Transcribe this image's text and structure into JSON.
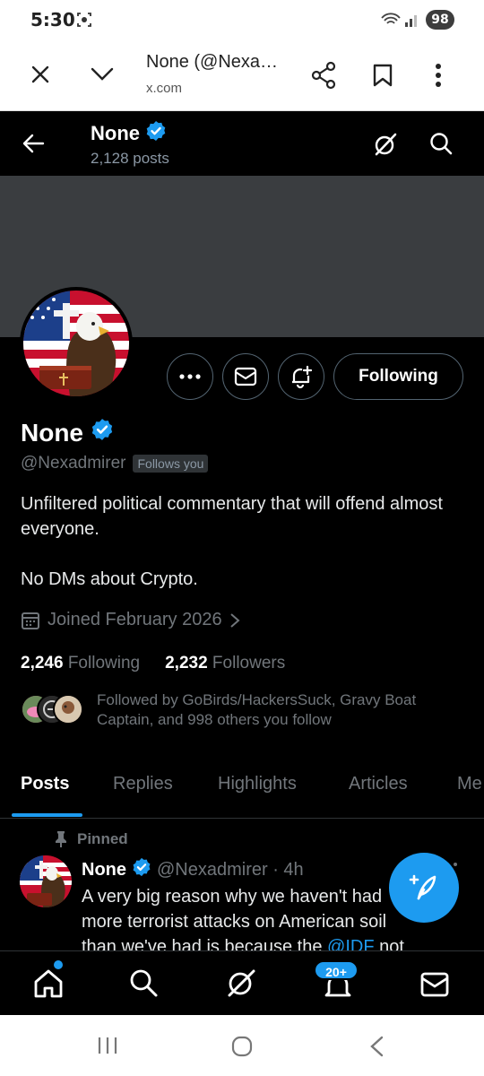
{
  "status_bar": {
    "time": "5:30",
    "battery": "98"
  },
  "browser": {
    "title": "None (@Nexa…",
    "url": "x.com"
  },
  "header": {
    "name": "None",
    "posts": "2,128 posts"
  },
  "profile": {
    "name": "None",
    "handle": "@Nexadmirer",
    "follows_you": "Follows you",
    "following_button": "Following",
    "bio_line1": "Unfiltered political commentary that will offend almost everyone.",
    "bio_line2": "No DMs about Crypto.",
    "joined": "Joined February 2026",
    "following_count": "2,246",
    "following_label": "Following",
    "followers_count": "2,232",
    "followers_label": "Followers",
    "followed_by": "Followed by GoBirds/HackersSuck, Gravy Boat Captain, and 998 others you follow"
  },
  "tabs": [
    {
      "label": "Posts",
      "active": true
    },
    {
      "label": "Replies"
    },
    {
      "label": "Highlights"
    },
    {
      "label": "Articles"
    },
    {
      "label": "Me"
    }
  ],
  "pinned_post": {
    "pinned_label": "Pinned",
    "name": "None",
    "handle_time": "@Nexadmirer · 4h",
    "text_part1": "A very big reason why we haven't had more terrorist attacks on American soil than we've had is because the ",
    "mention": "@IDF",
    "text_part2": " not only"
  },
  "bottom_nav": {
    "notifications_badge": "20+"
  },
  "colors": {
    "accent": "#1d9bf0",
    "background": "#000000",
    "muted": "#71767b"
  }
}
